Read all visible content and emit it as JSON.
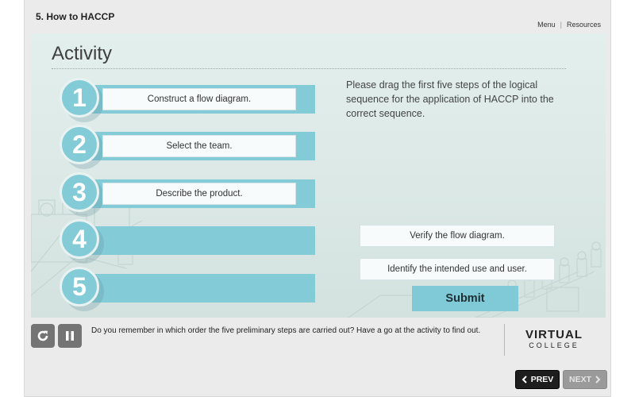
{
  "header": {
    "course_title": "5. How to HACCP",
    "menu_label": "Menu",
    "separator": "|",
    "resources_label": "Resources"
  },
  "activity": {
    "title": "Activity",
    "instructions": "Please drag the first five steps of the logical sequence for the application of HACCP into the correct sequence.",
    "steps": [
      {
        "number": "1",
        "placed_text": "Construct a flow diagram."
      },
      {
        "number": "2",
        "placed_text": "Select the team."
      },
      {
        "number": "3",
        "placed_text": "Describe the product."
      },
      {
        "number": "4",
        "placed_text": ""
      },
      {
        "number": "5",
        "placed_text": ""
      }
    ],
    "options": [
      "Verify the flow diagram.",
      "Identify the intended use and user."
    ],
    "submit_label": "Submit"
  },
  "footer": {
    "narration": "Do you remember in which order the five preliminary steps are carried out? Have a go at the activity to find out.",
    "logo_line1": "VIRTUAL",
    "logo_line2": "COLLEGE",
    "prev_label": "PREV",
    "next_label": "NEXT"
  },
  "colors": {
    "step_accent": "#84cbd8",
    "submit": "#7fcad6",
    "prev_button": "#1e1e1e",
    "next_button_disabled": "#9a9a9a"
  },
  "icons": [
    "replay-icon",
    "pause-icon",
    "chevron-left-icon",
    "chevron-right-icon"
  ]
}
